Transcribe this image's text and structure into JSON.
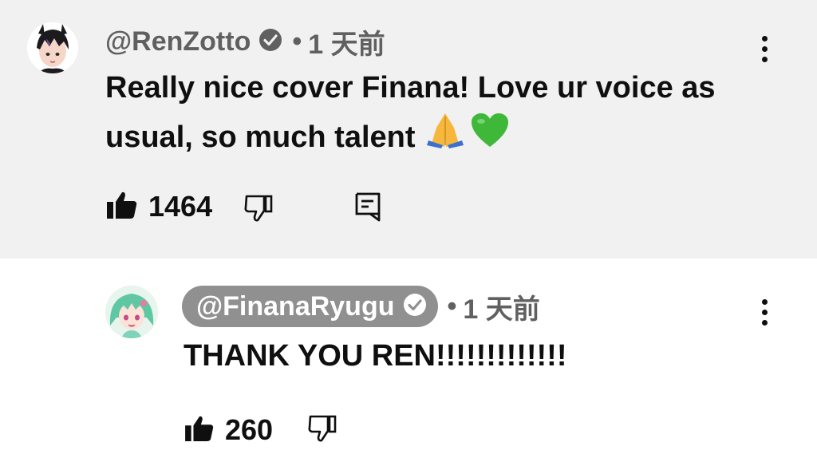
{
  "comments": [
    {
      "handle": "@RenZotto",
      "separator": "•",
      "time": "1 天前",
      "text_line1": "Really nice cover Finana! Love ur voice as",
      "text_line2": "usual, so much talent",
      "likes": "1464",
      "avatar_colors": {
        "bg": "#ffffff",
        "hair": "#1b1b1f",
        "skin": "#f6d6c8",
        "accent": "#6b4fa0"
      }
    },
    {
      "handle": "@FinanaRyugu",
      "separator": "•",
      "time": "1 天前",
      "text": "THANK YOU REN!!!!!!!!!!!!!",
      "likes": "260",
      "avatar_colors": {
        "bg": "#e8f4ee",
        "hair": "#5fc7a4",
        "skin": "#fbe3d7",
        "accent": "#e77ba5"
      }
    }
  ],
  "icons": [
    "verified-badge-icon",
    "folded-hands-emoji",
    "green-heart-emoji",
    "thumbs-up-icon",
    "thumbs-down-icon",
    "reply-icon",
    "more-vert-icon"
  ],
  "colors": {
    "highlight_bg": "#f1f1f1",
    "meta_text": "#606060",
    "pill_bg": "#909090",
    "heart": "#3fb83a"
  }
}
